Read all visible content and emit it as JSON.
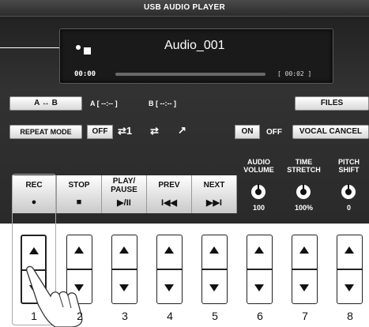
{
  "window": {
    "title": "USB AUDIO PLAYER"
  },
  "player": {
    "filename": "Audio_001",
    "elapsed": "00:00",
    "total": "[ 00:02 ]",
    "state_icon": "stop-icon",
    "progress": 0
  },
  "ab": {
    "button": "A ↔ B",
    "a_value": "A [ --:-- ]",
    "b_value": "B [ --:-- ]"
  },
  "files_label": "FILES",
  "repeat": {
    "label": "REPEAT MODE",
    "off": "OFF",
    "icon1": "⇄1",
    "icon2": "⇄",
    "icon3": "↗"
  },
  "vocal": {
    "on": "ON",
    "off": "OFF",
    "label": "VOCAL CANCEL"
  },
  "knobs": [
    {
      "title1": "AUDIO",
      "title2": "VOLUME",
      "value": "100"
    },
    {
      "title1": "TIME",
      "title2": "STRETCH",
      "value": "100%"
    },
    {
      "title1": "PITCH",
      "title2": "SHIFT",
      "value": "0"
    }
  ],
  "soft_buttons": [
    {
      "line1": "REC",
      "line2": "",
      "glyph": "●"
    },
    {
      "line1": "STOP",
      "line2": "",
      "glyph": "■"
    },
    {
      "line1": "PLAY/",
      "line2": "PAUSE",
      "glyph": "▶/II"
    },
    {
      "line1": "PREV",
      "line2": "",
      "glyph": "I◀◀"
    },
    {
      "line1": "NEXT",
      "line2": "",
      "glyph": "▶▶I"
    }
  ],
  "physical_numbers": [
    "1",
    "2",
    "3",
    "4",
    "5",
    "6",
    "7",
    "8"
  ]
}
